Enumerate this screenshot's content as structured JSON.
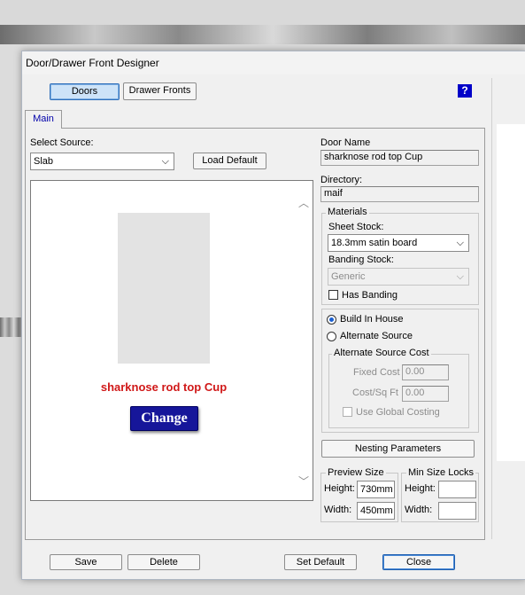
{
  "window": {
    "title": "Door/Drawer Front Designer"
  },
  "toolbar": {
    "doors_label": "Doors",
    "drawer_fronts_label": "Drawer Fronts",
    "help_label": "?"
  },
  "tabs": {
    "main": "Main"
  },
  "source": {
    "label": "Select Source:",
    "value": "Slab",
    "load_default": "Load Default"
  },
  "door": {
    "name_label": "Door Name",
    "name_value": "sharknose rod top Cup",
    "directory_label": "Directory:",
    "directory_value": "maif"
  },
  "materials": {
    "title": "Materials",
    "sheet_stock_label": "Sheet Stock:",
    "sheet_stock_value": "18.3mm satin board",
    "banding_stock_label": "Banding Stock:",
    "banding_stock_value": "Generic",
    "has_banding_label": "Has Banding"
  },
  "source_options": {
    "build_in_house": "Build In House",
    "alternate_source": "Alternate Source",
    "alt_cost_title": "Alternate Source Cost",
    "fixed_cost_label": "Fixed Cost",
    "fixed_cost_value": "0.00",
    "cost_sqft_label": "Cost/Sq Ft",
    "cost_sqft_value": "0.00",
    "use_global_costing": "Use Global Costing"
  },
  "nesting": {
    "label": "Nesting Parameters"
  },
  "preview_size": {
    "title": "Preview Size",
    "height_label": "Height:",
    "height_value": "730mm",
    "width_label": "Width:",
    "width_value": "450mm"
  },
  "min_size": {
    "title": "Min Size Locks",
    "height_label": "Height:",
    "height_value": "",
    "width_label": "Width:",
    "width_value": ""
  },
  "preview": {
    "caption": "sharknose rod top Cup",
    "change_label": "Change",
    "caption_color": "#d01818"
  },
  "footer": {
    "save": "Save",
    "delete": "Delete",
    "set_default": "Set Default",
    "close": "Close"
  }
}
